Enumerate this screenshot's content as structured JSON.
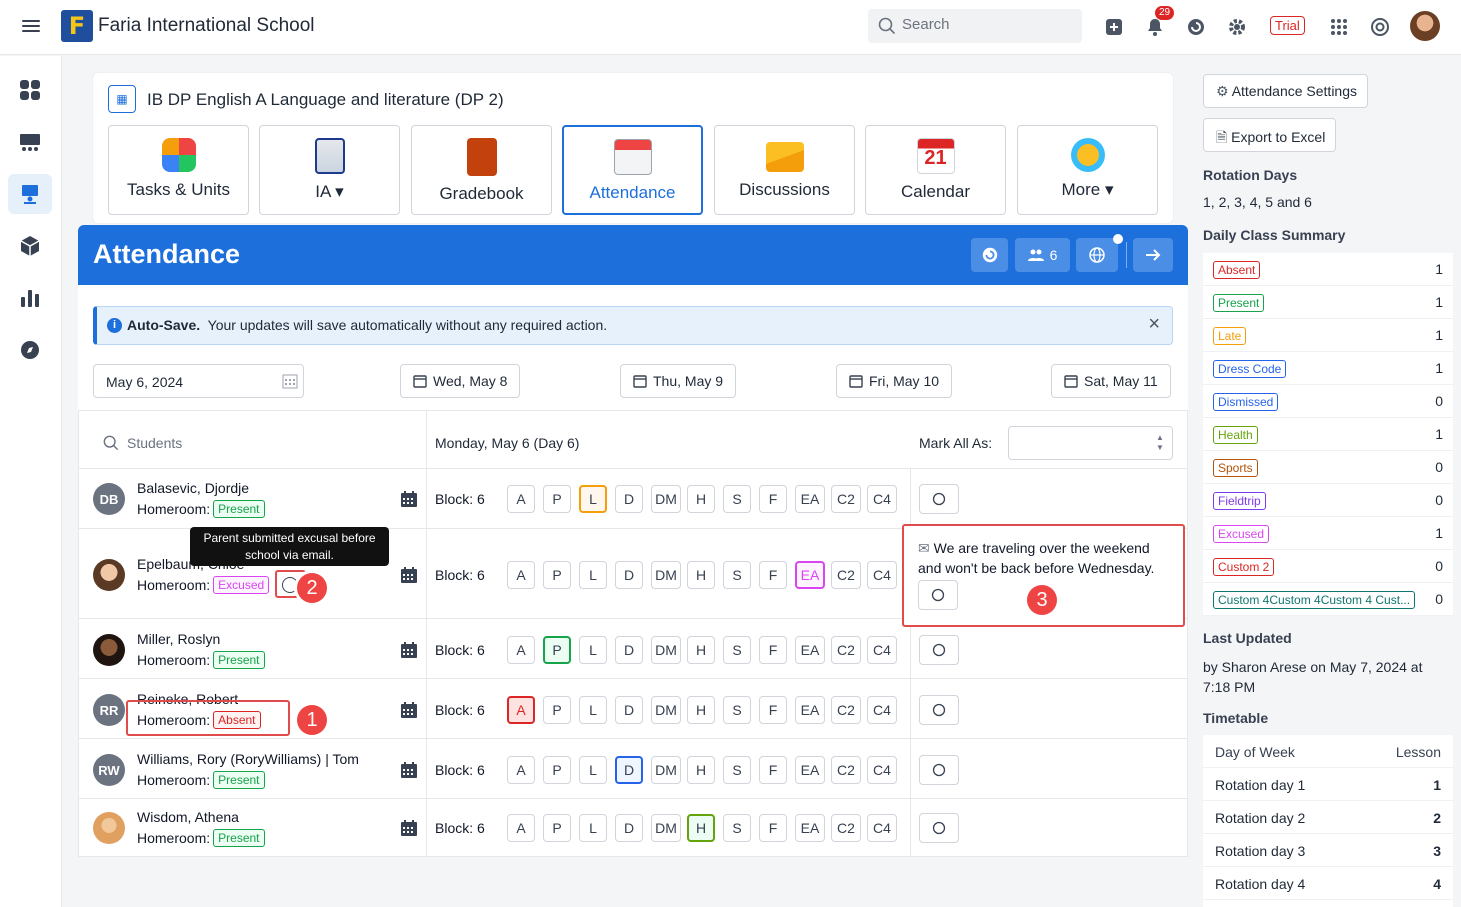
{
  "topbar": {
    "school_name": "Faria International School",
    "search_placeholder": "Search",
    "notification_count": "29",
    "trial_label": "Trial"
  },
  "course": {
    "title": "IB DP English A Language and literature (DP 2)"
  },
  "tools": [
    {
      "label": "Tasks & Units"
    },
    {
      "label": "IA ▾"
    },
    {
      "label": "Gradebook"
    },
    {
      "label": "Attendance"
    },
    {
      "label": "Discussions"
    },
    {
      "label": "Calendar"
    },
    {
      "label": "More ▾"
    }
  ],
  "calendar_day": "21",
  "attendance": {
    "title": "Attendance",
    "group_count": "6",
    "info_bold": "Auto-Save.",
    "info_text": "Your updates will save automatically without any required action.",
    "date_value": "May 6, 2024",
    "dates": [
      "Wed, May 8",
      "Thu, May 9",
      "Fri, May 10",
      "Sat, May 11"
    ],
    "students_placeholder": "Students",
    "day_heading": "Monday, May 6 (Day 6)",
    "mark_all_label": "Mark All As:",
    "homeroom_label": "Homeroom:",
    "block_label": "Block: 6",
    "codes": [
      "A",
      "P",
      "L",
      "D",
      "DM",
      "H",
      "S",
      "F",
      "EA",
      "C2",
      "C4"
    ],
    "students": [
      {
        "initials": "DB",
        "name": "Balasevic, Djordje",
        "status": "Present",
        "selected": "L"
      },
      {
        "initials": "",
        "name": "Epelbaum, Chloe",
        "status": "Excused",
        "selected": "EA"
      },
      {
        "initials": "",
        "name": "Miller, Roslyn",
        "status": "Present",
        "selected": "P"
      },
      {
        "initials": "RR",
        "name": "Reineke, Robert",
        "status": "Absent",
        "selected": "A"
      },
      {
        "initials": "RW",
        "name": "Williams, Rory (RoryWilliams) | Tom",
        "status": "Present",
        "selected": "D"
      },
      {
        "initials": "",
        "name": "Wisdom, Athena",
        "status": "Present",
        "selected": "H"
      }
    ],
    "tooltip": "Parent submitted excusal before school via email.",
    "comment_text": "We are traveling over the weekend and won't be back before Wednesday.",
    "callouts": [
      "1",
      "2",
      "3"
    ]
  },
  "right_panel": {
    "settings_label": "Attendance Settings",
    "export_label": "Export to Excel",
    "rotation_heading": "Rotation Days",
    "rotation_value": "1, 2, 3, 4, 5 and 6",
    "summary_heading": "Daily Class Summary",
    "summary": [
      {
        "label": "Absent",
        "count": "1",
        "color": "#dc2626"
      },
      {
        "label": "Present",
        "count": "1",
        "color": "#16a34a"
      },
      {
        "label": "Late",
        "count": "1",
        "color": "#f59e0b"
      },
      {
        "label": "Dress Code",
        "count": "1",
        "color": "#2563eb"
      },
      {
        "label": "Dismissed",
        "count": "0",
        "color": "#2563eb"
      },
      {
        "label": "Health",
        "count": "1",
        "color": "#65a30d"
      },
      {
        "label": "Sports",
        "count": "0",
        "color": "#b45309"
      },
      {
        "label": "Fieldtrip",
        "count": "0",
        "color": "#7c3aed"
      },
      {
        "label": "Excused",
        "count": "1",
        "color": "#d946ef"
      },
      {
        "label": "Custom 2",
        "count": "0",
        "color": "#dc2626"
      },
      {
        "label": "Custom 4Custom 4Custom 4 Cust...",
        "count": "0",
        "color": "#0f766e"
      }
    ],
    "last_updated_heading": "Last Updated",
    "last_updated_value": "by Sharon Arese on May 7, 2024 at 7:18 PM",
    "timetable_heading": "Timetable",
    "timetable_cols": [
      "Day of Week",
      "Lesson"
    ],
    "timetable": [
      {
        "day": "Rotation day 1",
        "lesson": "1"
      },
      {
        "day": "Rotation day 2",
        "lesson": "2"
      },
      {
        "day": "Rotation day 3",
        "lesson": "3"
      },
      {
        "day": "Rotation day 4",
        "lesson": "4"
      }
    ]
  }
}
